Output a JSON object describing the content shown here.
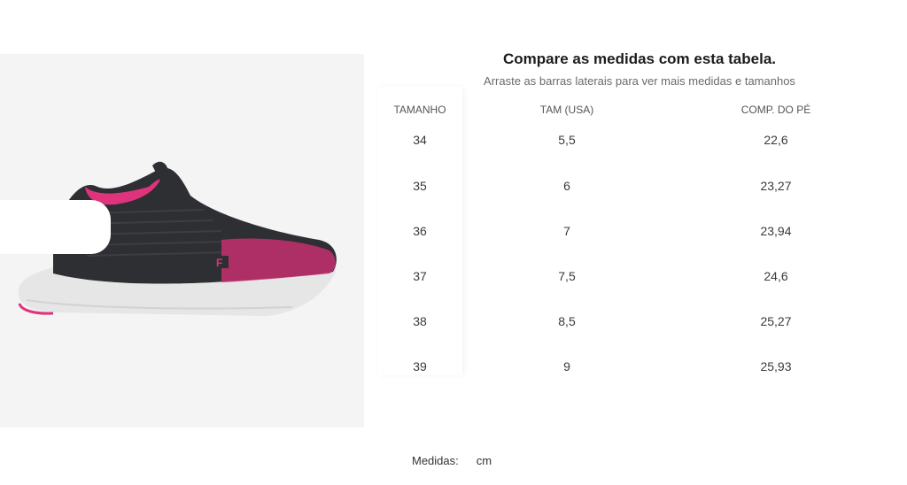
{
  "header": {
    "title": "Compare as medidas com esta tabela.",
    "subtitle": "Arraste as barras laterais para ver mais medidas e tamanhos"
  },
  "product_image": {
    "icon": "sneaker-image",
    "brand_logo_text": "F",
    "colors": {
      "upper": "#2e2f33",
      "accent": "#e0337d",
      "sole": "#e8e8e8"
    }
  },
  "size_table": {
    "columns": [
      "TAMANHO",
      "TAM (USA)",
      "COMP. DO PÉ"
    ],
    "rows": [
      {
        "tamanho": "34",
        "tam_usa": "5,5",
        "comp": "22,6"
      },
      {
        "tamanho": "35",
        "tam_usa": "6",
        "comp": "23,27"
      },
      {
        "tamanho": "36",
        "tam_usa": "7",
        "comp": "23,94"
      },
      {
        "tamanho": "37",
        "tam_usa": "7,5",
        "comp": "24,6"
      },
      {
        "tamanho": "38",
        "tam_usa": "8,5",
        "comp": "25,27"
      },
      {
        "tamanho": "39",
        "tam_usa": "9",
        "comp": "25,93"
      }
    ]
  },
  "footer": {
    "units_label": "Medidas:",
    "units_value": "cm"
  }
}
